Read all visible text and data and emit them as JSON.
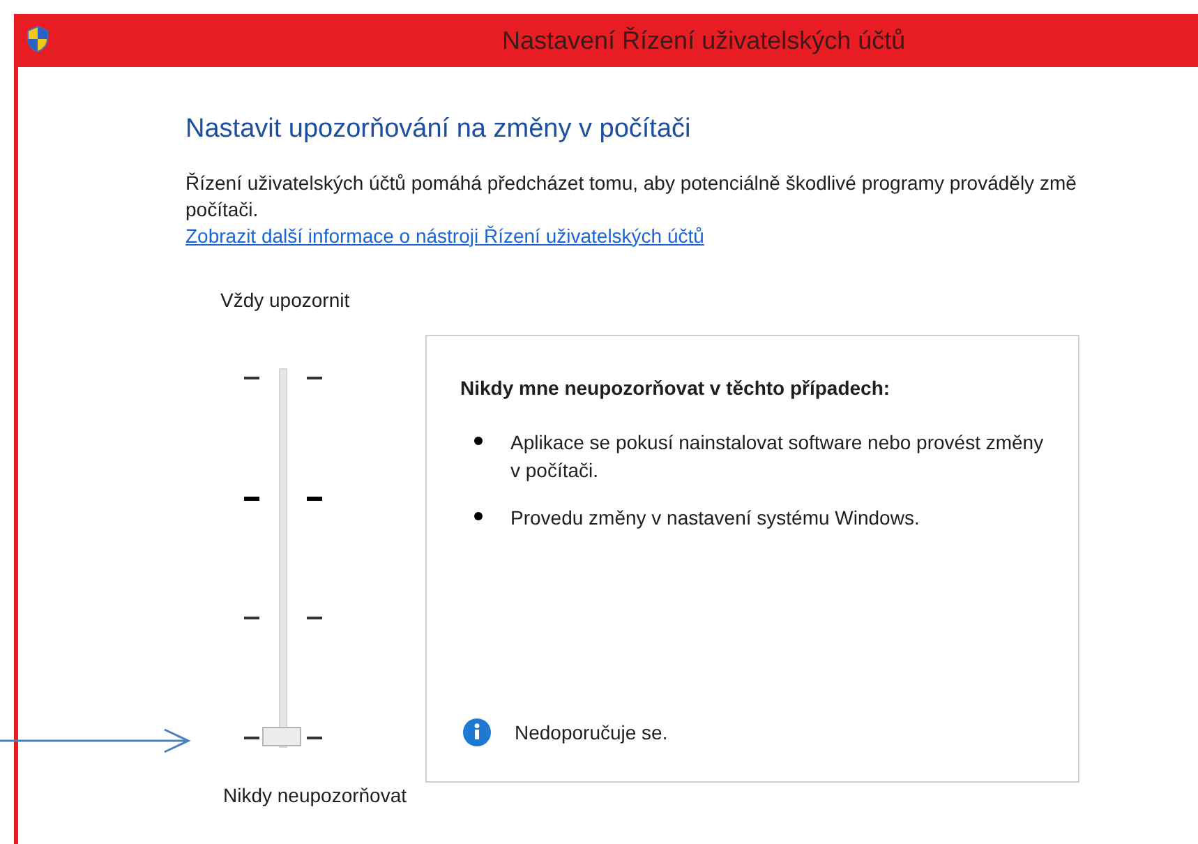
{
  "window": {
    "title": "Nastavení Řízení uživatelských účtů"
  },
  "heading": "Nastavit upozorňování na změny v počítači",
  "description_lines": [
    "Řízení uživatelských účtů pomáhá předcházet tomu, aby potenciálně škodlivé programy prováděly změ",
    "počítači."
  ],
  "link": "Zobrazit další informace o nástroji Řízení uživatelských účtů",
  "slider": {
    "top_label": "Vždy upozornit",
    "bottom_label": "Nikdy neupozorňovat",
    "level": 0
  },
  "panel": {
    "title": "Nikdy mne neupozorňovat v těchto případech:",
    "bullets": [
      "Aplikace se pokusí nainstalovat software nebo provést změny v počítači.",
      "Provedu změny v nastavení systému Windows."
    ],
    "note": "Nedoporučuje se."
  }
}
